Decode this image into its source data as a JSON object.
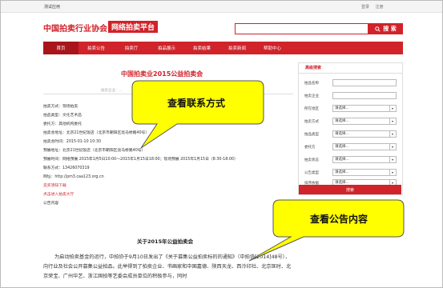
{
  "topbar": {
    "left": "测试应用",
    "login": "登录",
    "register": "注册"
  },
  "header": {
    "logo": "中国拍卖行业协会",
    "badge": "网络拍卖平台",
    "search_button": "搜 索"
  },
  "nav": {
    "items": [
      "首页",
      "拍卖公告",
      "拍卖厅",
      "拍品展示",
      "拍卖结果",
      "拍卖新闻",
      "帮助中心"
    ],
    "active_index": 0
  },
  "main": {
    "title": "中国拍卖业2015公益拍卖会",
    "meta": "拍卖企业：...",
    "details": [
      "拍卖方式：现场拍卖",
      "拍品类型：文化艺术品",
      "委托方：其他机构委托",
      "拍卖会地址：北京21世纪饭店（北京市朝阳区亮马桥路40号）",
      "拍卖会时间：2015-01-10 10:30",
      "预展地址：北京21世纪饭店（北京市朝阳区亮马桥路40号）",
      "预展时间：网络预展 2015年1月5日10:00～2015年1月15日18:00；现场预展 2015年1月15日（8:30-18:00）",
      "联系方式：13426070319",
      "网址：http://pm3.caa123.org.cn"
    ],
    "links": [
      "竞买须知下载",
      "点击进入拍卖大厅"
    ],
    "notice_label": "公告内容",
    "notice_title": "关于2015年公益拍卖会",
    "notice_body": "为启动拍卖基金的运行，中拍协于9月10日发出了《关于募集公益拍卖标的的通知》（中拍协[2014]48号），向行业及社会公开募集公益拍品。此举得到了拍卖企业、书画家和中国嘉德、陕西天龙、西泠印社、北京匡时、北京荣宝、广州华艺、浙江国拍等艺委会成员单位的积极参与，同时"
  },
  "sidebar": {
    "title": "高级搜索",
    "fields": [
      {
        "label": "拍品名称",
        "value": ""
      },
      {
        "label": "拍卖企业",
        "value": ""
      },
      {
        "label": "所在地区",
        "value": "请选择..."
      },
      {
        "label": "拍卖方式",
        "value": "请选择..."
      },
      {
        "label": "拍品类型",
        "value": "请选择..."
      },
      {
        "label": "委托方",
        "value": "请选择..."
      },
      {
        "label": "拍卖状态",
        "value": "请选择..."
      },
      {
        "label": "公告类型",
        "value": "请选择..."
      },
      {
        "label": "排序依据",
        "value": "请选择..."
      }
    ],
    "search_button": "搜索"
  },
  "callouts": {
    "contact": "查看联系方式",
    "notice": "查看公告内容"
  },
  "colors": {
    "brand": "#d0232a",
    "callout_fill": "#ffff00"
  }
}
